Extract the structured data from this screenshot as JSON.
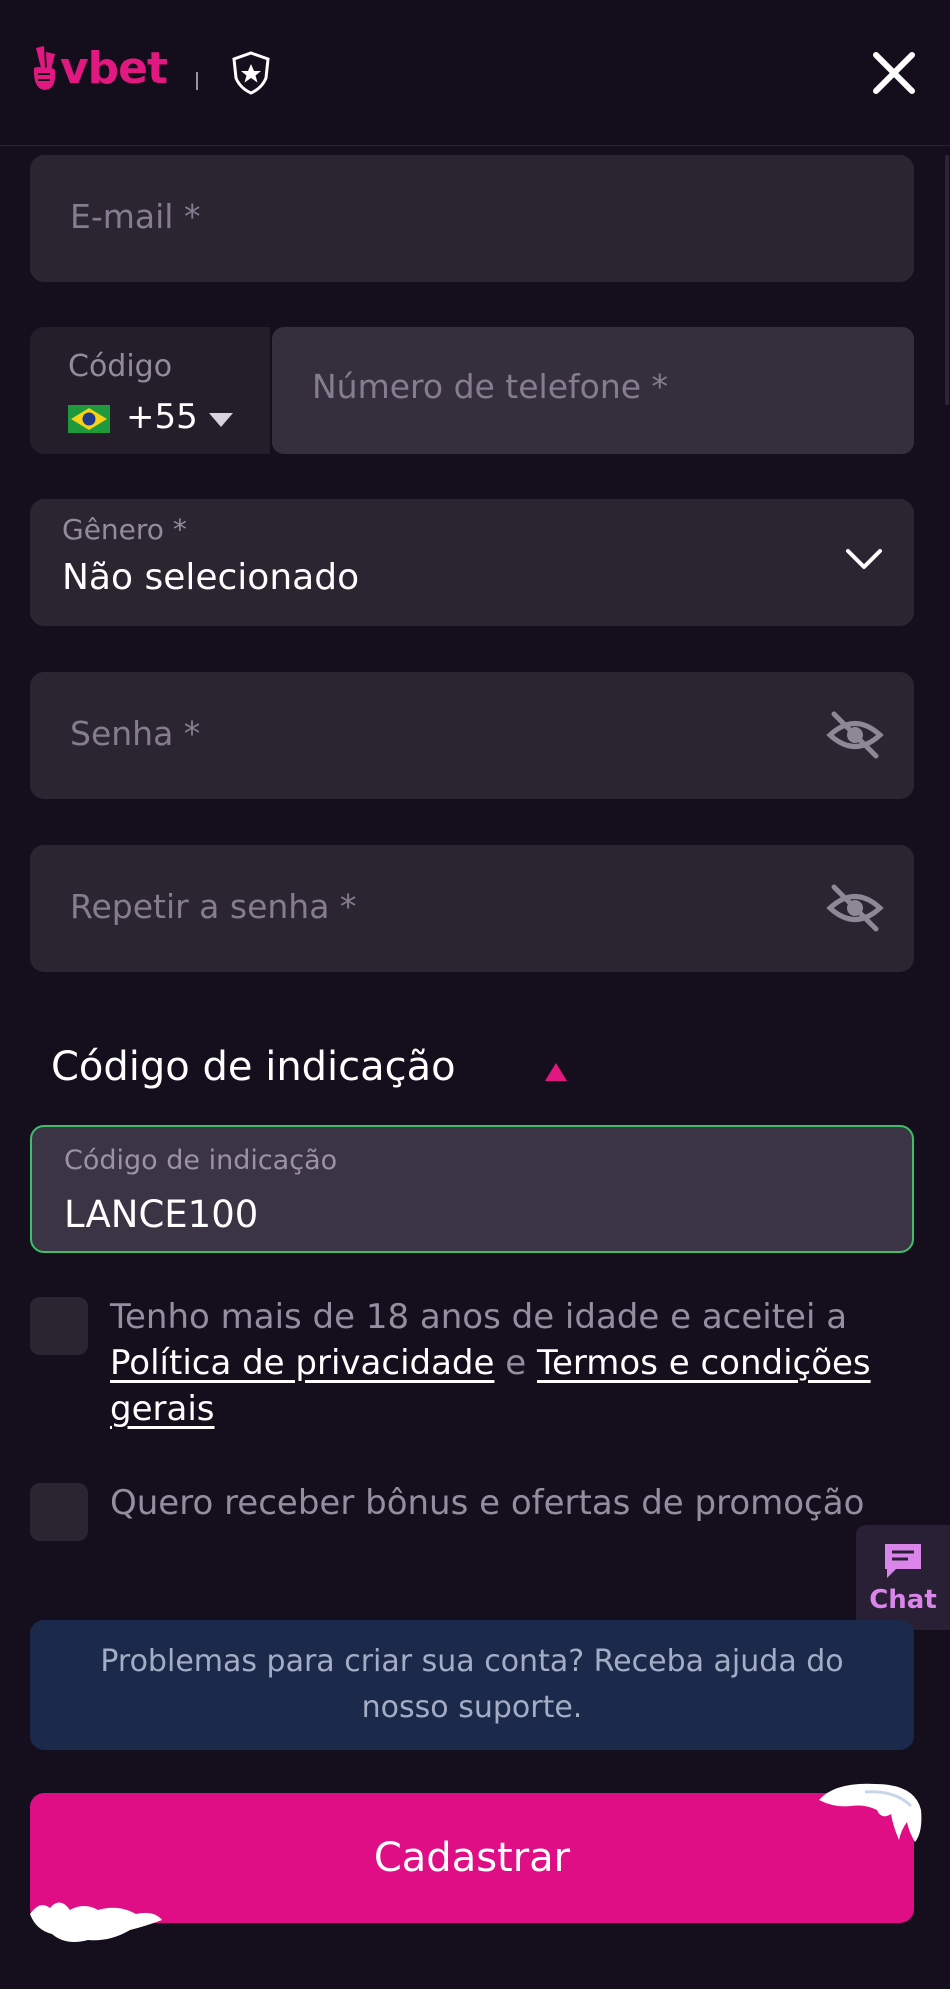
{
  "header": {
    "logo_text": "vbet",
    "colors": {
      "brand": "#e0187f"
    }
  },
  "form": {
    "email": {
      "placeholder": "E-mail *"
    },
    "phone": {
      "code_label": "Código",
      "country_code": "+55",
      "placeholder": "Número de telefone *"
    },
    "gender": {
      "label": "Gênero *",
      "value": "Não selecionado"
    },
    "password": {
      "placeholder": "Senha *"
    },
    "repeat_password": {
      "placeholder": "Repetir a senha *"
    },
    "referral": {
      "section_title": "Código de indicação",
      "label": "Código de indicação",
      "value": "LANCE100"
    },
    "age_consent": {
      "text_before": "Tenho mais de 18 anos de idade e aceitei a",
      "privacy_link": "Política de privacidade",
      "and": "e",
      "terms_link": "Termos e condições gerais"
    },
    "promo_consent": {
      "text": "Quero receber bônus e ofertas de promoção"
    },
    "help": {
      "text": "Problemas para criar sua conta? Receba ajuda do nosso suporte."
    },
    "submit_label": "Cadastrar"
  },
  "chat": {
    "label": "Chat"
  }
}
